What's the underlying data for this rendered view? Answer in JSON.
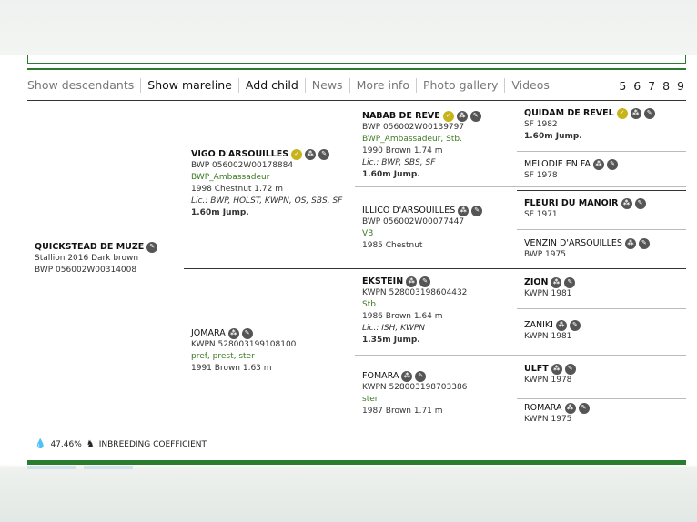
{
  "toolbar": {
    "items": [
      "Show descendants",
      "Show mareline",
      "Add child",
      "News",
      "More info",
      "Photo gallery",
      "Videos"
    ],
    "pages": "5 6 7 8 9"
  },
  "subject": {
    "name": "QUICKSTEAD DE MUZE",
    "line1": "Stallion 2016 Dark brown",
    "line2": "BWP 056002W00314008"
  },
  "sire": {
    "name": "VIGO D'ARSOUILLES",
    "reg": "BWP 056002W00178884",
    "studbook": "BWP_Ambassadeur",
    "info": "1998 Chestnut 1.72 m",
    "lic": "Lic.: BWP, HOLST, KWPN, OS, SBS, SF",
    "jump": "1.60m Jump."
  },
  "dam": {
    "name": "JOMARA",
    "reg": "KWPN 528003199108100",
    "studbook": "pref, prest, ster",
    "info": "1991 Brown 1.63 m"
  },
  "ss": {
    "name": "NABAB DE REVE",
    "reg": "BWP 056002W00139797",
    "studbook": "BWP_Ambassadeur, Stb.",
    "info": "1990 Brown 1.74 m",
    "lic": "Lic.: BWP, SBS, SF",
    "jump": "1.60m Jump."
  },
  "sd": {
    "name": "ILLICO D'ARSOUILLES",
    "reg": "BWP 056002W00077447",
    "studbook": "VB",
    "info": "1985 Chestnut"
  },
  "ds": {
    "name": "EKSTEIN",
    "reg": "KWPN 528003198604432",
    "studbook": "Stb.",
    "info": "1986 Brown 1.64 m",
    "lic": "Lic.: ISH, KWPN",
    "jump": "1.35m Jump."
  },
  "dd": {
    "name": "FOMARA",
    "reg": "KWPN 528003198703386",
    "studbook": "ster",
    "info": "1987 Brown 1.71 m"
  },
  "g3": [
    {
      "name": "QUIDAM DE REVEL",
      "line1": "SF 1982",
      "jump": "1.60m Jump."
    },
    {
      "name": "MELODIE EN FA",
      "line1": "SF 1978"
    },
    {
      "name": "FLEURI DU MANOIR",
      "line1": "SF 1971"
    },
    {
      "name": "VENZIN D'ARSOUILLES",
      "line1": "BWP 1975"
    },
    {
      "name": "ZION",
      "line1": "KWPN 1981"
    },
    {
      "name": "ZANIKI",
      "line1": "KWPN 1981"
    },
    {
      "name": "ULFT",
      "line1": "KWPN 1978"
    },
    {
      "name": "ROMARA",
      "line1": "KWPN 1975"
    }
  ],
  "inbreeding": {
    "value": "47.46%",
    "label": "INBREEDING COEFFICIENT"
  },
  "colors": {
    "accent_green": "#2a7d2e",
    "studbook_green": "#3d7a22",
    "badge_yellow": "#c7b41a",
    "badge_gray": "#555555"
  }
}
